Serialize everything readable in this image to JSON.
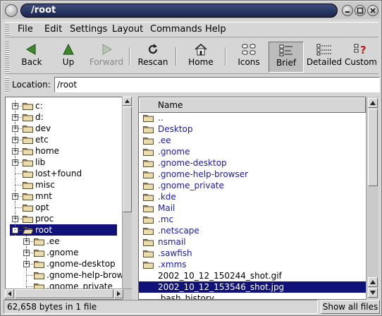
{
  "window": {
    "title": "/root",
    "buttons": [
      "minimize",
      "maximize",
      "close"
    ]
  },
  "menubar": [
    {
      "label": "File"
    },
    {
      "label": "Edit"
    },
    {
      "label": "Settings"
    },
    {
      "label": "Layout"
    },
    {
      "label": "Commands"
    },
    {
      "label": "Help"
    }
  ],
  "toolbar": [
    {
      "label": "Back",
      "icon": "arrow-left-icon",
      "enabled": true
    },
    {
      "label": "Up",
      "icon": "arrow-up-icon",
      "enabled": true
    },
    {
      "label": "Forward",
      "icon": "arrow-right-icon",
      "enabled": false
    },
    {
      "label": "Rescan",
      "icon": "refresh-icon",
      "enabled": true
    },
    {
      "label": "Home",
      "icon": "home-icon",
      "enabled": true
    },
    {
      "label": "Icons",
      "icon": "icons-view-icon",
      "enabled": true
    },
    {
      "label": "Brief",
      "icon": "brief-view-icon",
      "enabled": true,
      "active": true
    },
    {
      "label": "Detailed",
      "icon": "detailed-view-icon",
      "enabled": true
    },
    {
      "label": "Custom",
      "icon": "custom-view-icon",
      "enabled": true
    }
  ],
  "location": {
    "label": "Location:",
    "value": "/root"
  },
  "tree": [
    {
      "label": "c:",
      "expander": "+"
    },
    {
      "label": "d:",
      "expander": "+"
    },
    {
      "label": "dev",
      "expander": "+"
    },
    {
      "label": "etc",
      "expander": "+"
    },
    {
      "label": "home",
      "expander": "+"
    },
    {
      "label": "lib",
      "expander": "+"
    },
    {
      "label": "lost+found",
      "expander": ""
    },
    {
      "label": "misc",
      "expander": ""
    },
    {
      "label": "mnt",
      "expander": "+"
    },
    {
      "label": "opt",
      "expander": ""
    },
    {
      "label": "proc",
      "expander": "+"
    },
    {
      "label": "root",
      "expander": "-",
      "selected": true
    },
    {
      "label": ".ee",
      "expander": "+",
      "child": true
    },
    {
      "label": ".gnome",
      "expander": "+",
      "child": true
    },
    {
      "label": ".gnome-desktop",
      "expander": "+",
      "child": true
    },
    {
      "label": ".gnome-help-browser",
      "expander": "",
      "child": true
    },
    {
      "label": ".gnome_private",
      "expander": "",
      "child": true
    }
  ],
  "files": {
    "column": "Name",
    "items": [
      {
        "label": "..",
        "type": "folder"
      },
      {
        "label": "Desktop",
        "type": "folder"
      },
      {
        "label": ".ee",
        "type": "folder"
      },
      {
        "label": ".gnome",
        "type": "folder"
      },
      {
        "label": ".gnome-desktop",
        "type": "folder"
      },
      {
        "label": ".gnome-help-browser",
        "type": "folder"
      },
      {
        "label": ".gnome_private",
        "type": "folder"
      },
      {
        "label": ".kde",
        "type": "folder"
      },
      {
        "label": "Mail",
        "type": "folder"
      },
      {
        "label": ".mc",
        "type": "folder"
      },
      {
        "label": ".netscape",
        "type": "folder"
      },
      {
        "label": "nsmail",
        "type": "folder"
      },
      {
        "label": ".sawfish",
        "type": "folder"
      },
      {
        "label": ".xmms",
        "type": "folder"
      },
      {
        "label": "2002_10_12_150244_shot.gif",
        "type": "file"
      },
      {
        "label": "2002_10_12_153546_shot.jpg",
        "type": "file",
        "selected": true
      },
      {
        "label": ".bash_history",
        "type": "file"
      }
    ]
  },
  "status": {
    "text": "62,658 bytes in 1 file",
    "button": "Show all files"
  },
  "colors": {
    "selection": "#10127a",
    "folder_text": "#1a1aa8",
    "title_bg": "#1a2550"
  }
}
